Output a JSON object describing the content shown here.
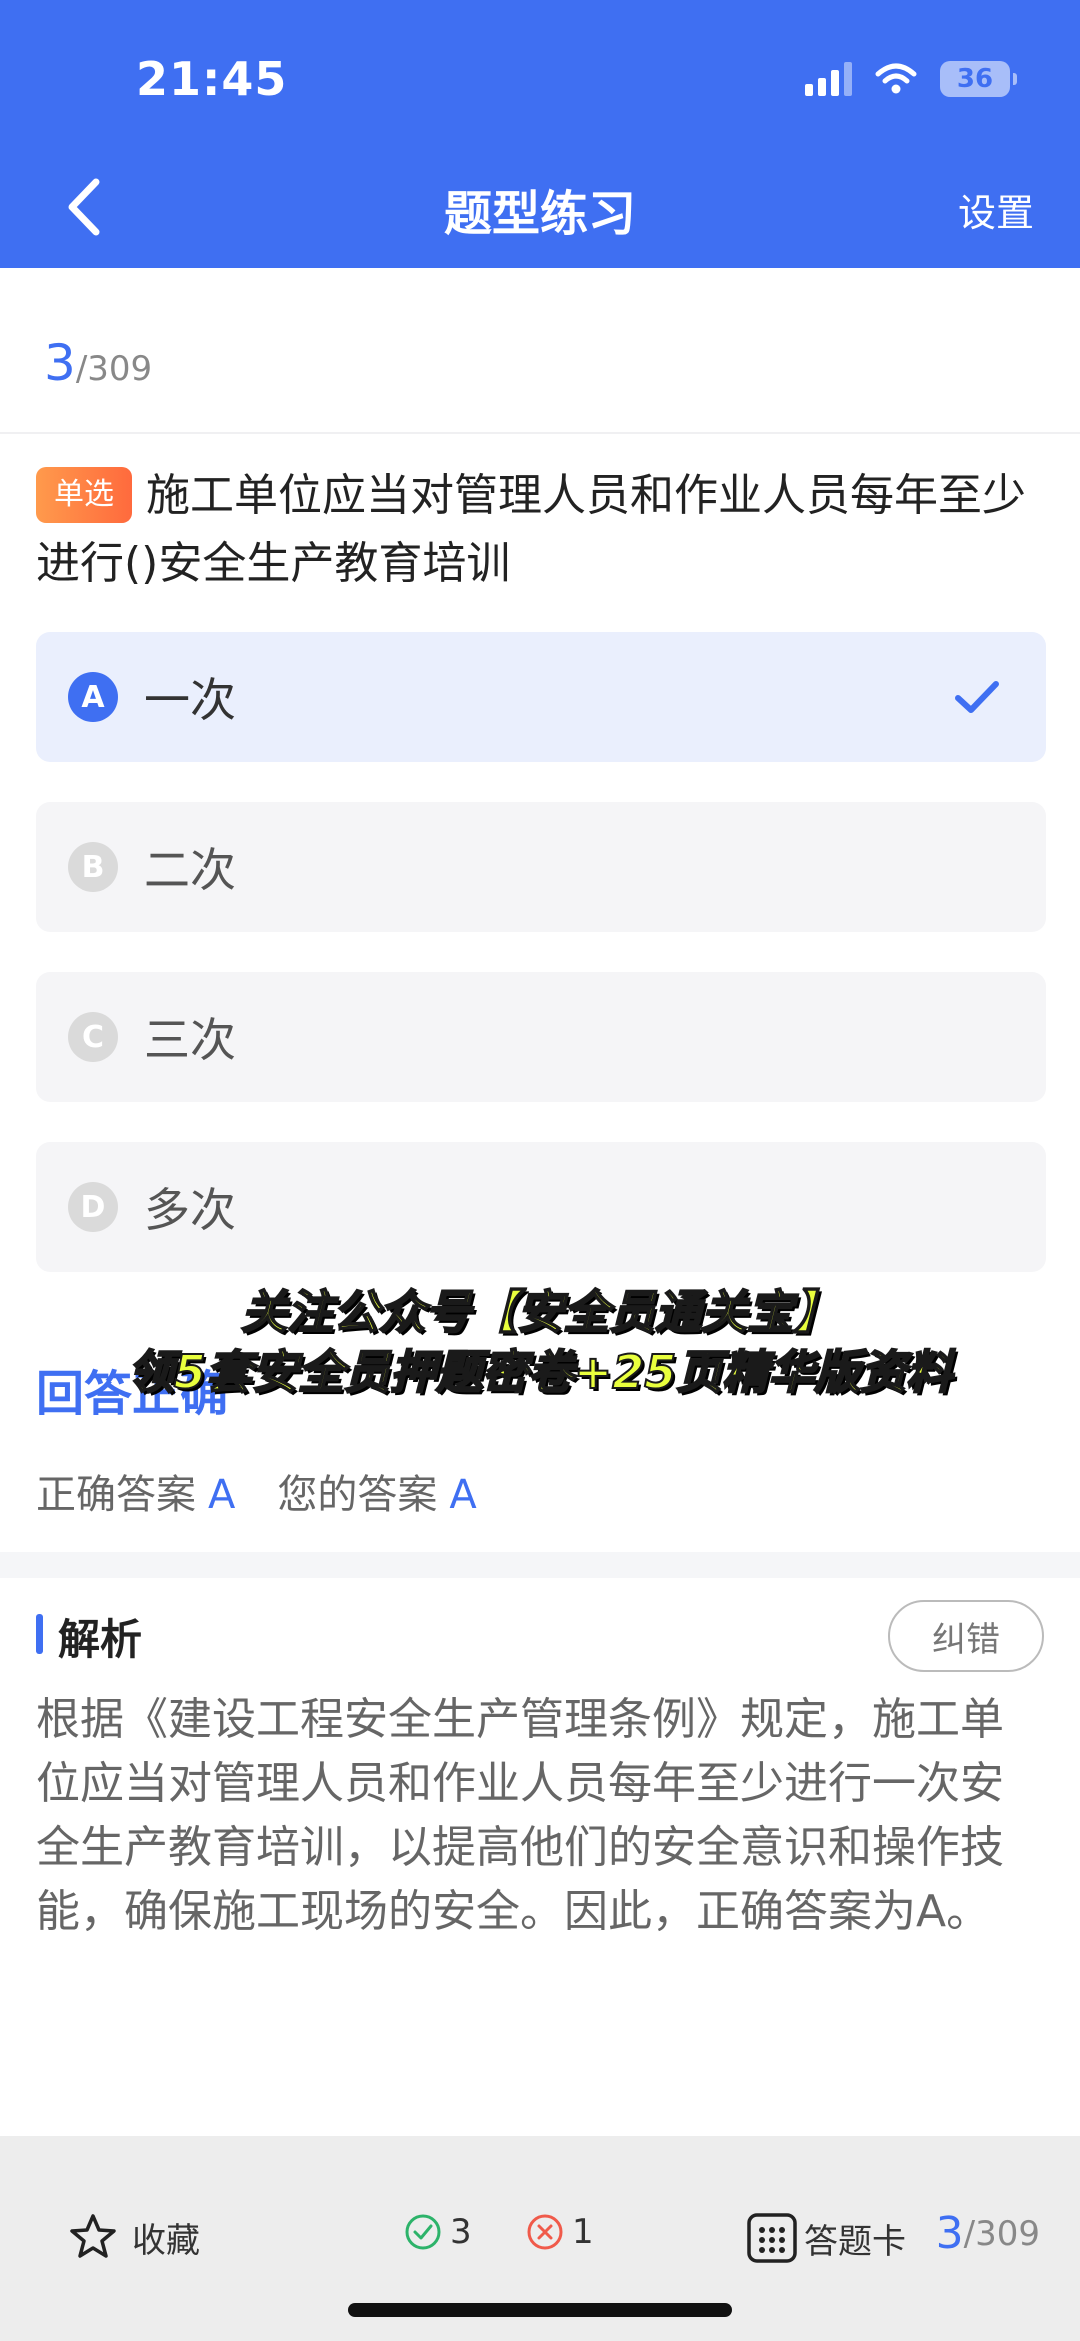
{
  "status_bar": {
    "time": "21:45",
    "battery": "36"
  },
  "nav": {
    "title": "题型练习",
    "settings": "设置"
  },
  "counter": {
    "current": "3",
    "total": "/309"
  },
  "question": {
    "tag": "单选",
    "text": "施工单位应当对管理人员和作业人员每年至少进行()安全生产教育培训"
  },
  "options": [
    {
      "letter": "A",
      "text": "一次",
      "selected": true
    },
    {
      "letter": "B",
      "text": "二次",
      "selected": false
    },
    {
      "letter": "C",
      "text": "三次",
      "selected": false
    },
    {
      "letter": "D",
      "text": "多次",
      "selected": false
    }
  ],
  "result": {
    "title": "回答正确",
    "correct_label": "正确答案",
    "correct_value": "A",
    "your_label": "您的答案",
    "your_value": "A"
  },
  "overlay": {
    "line1": "关注公众号【安全员通关宝】",
    "line2": "领5套安全员押题密卷+25页精华版资料"
  },
  "analysis": {
    "title": "解析",
    "report_button": "纠错",
    "text": "根据《建设工程安全生产管理条例》规定，施工单位应当对管理人员和作业人员每年至少进行一次安全生产教育培训，以提高他们的安全意识和操作技能，确保施工现场的安全。因此，正确答案为A。"
  },
  "bottom_bar": {
    "favorite": "收藏",
    "correct_count": "3",
    "wrong_count": "1",
    "answer_card": "答题卡",
    "progress_current": "3",
    "progress_total": "/309"
  },
  "colors": {
    "accent": "#3F6FF2",
    "tag_orange": "#FF7A45",
    "correct_green": "#2DB36A",
    "wrong_red": "#F05A4A"
  },
  "icons": {
    "back": "chevron-left-icon",
    "check": "checkmark-icon",
    "favorite": "star-icon",
    "correct": "check-circle-icon",
    "wrong": "x-circle-icon",
    "answer_card": "grid-icon"
  }
}
